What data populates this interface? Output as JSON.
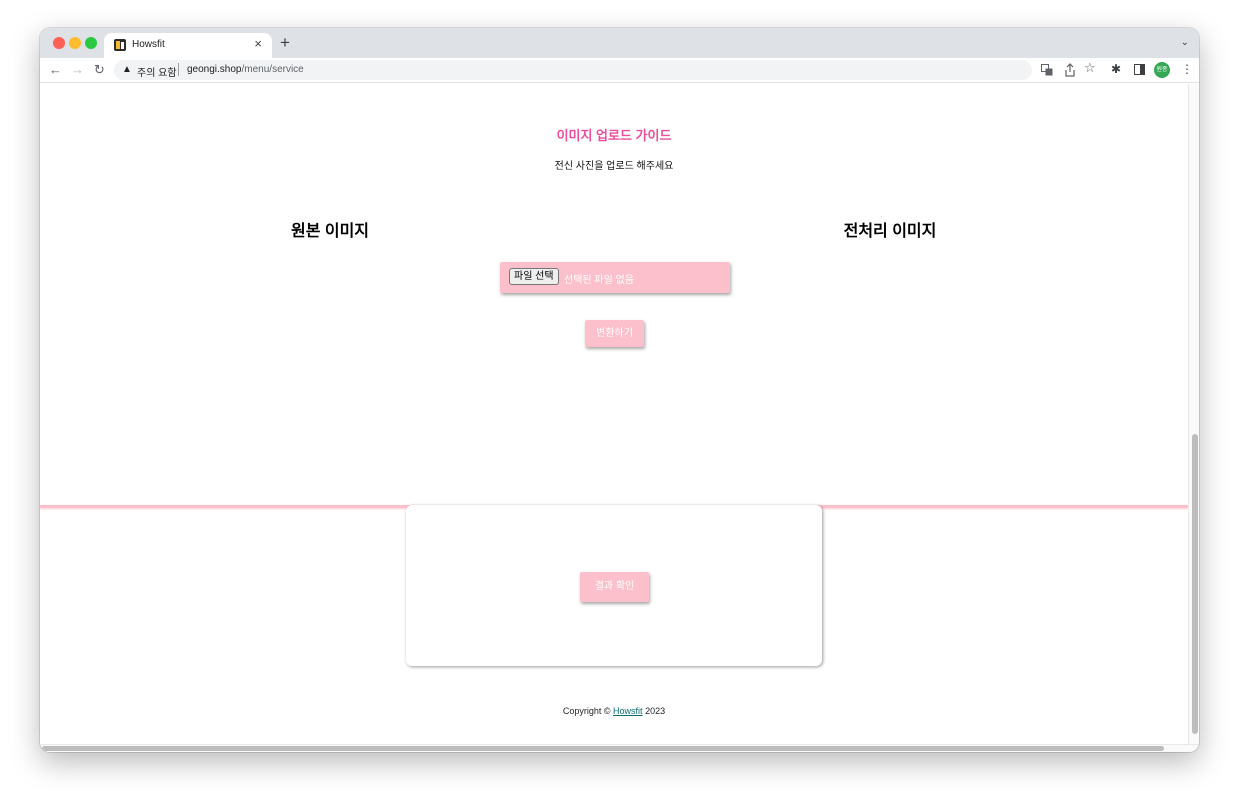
{
  "browser": {
    "tab_title": "Howsfit",
    "tab_close": "×",
    "new_tab": "+",
    "security_warning": "주의 요함",
    "url_host": "geongi.shop",
    "url_path": "/menu/service",
    "profile_initials": "원종"
  },
  "page": {
    "guide_title": "이미지 업로드 가이드",
    "guide_text": "전신 사진을 업로드 해주세요",
    "original_heading": "원본 이미지",
    "processed_heading": "전처리 이미지",
    "file_button": "파일 선택",
    "file_status": "선택된 파일 없음",
    "convert_button": "변환하기",
    "result_button": "결과 확인"
  },
  "footer": {
    "prefix": "Copyright © ",
    "link": "Howsfit",
    "suffix": " 2023"
  },
  "colors": {
    "accent_pink": "#fbc0cb",
    "title_pink": "#ec4e9b"
  }
}
